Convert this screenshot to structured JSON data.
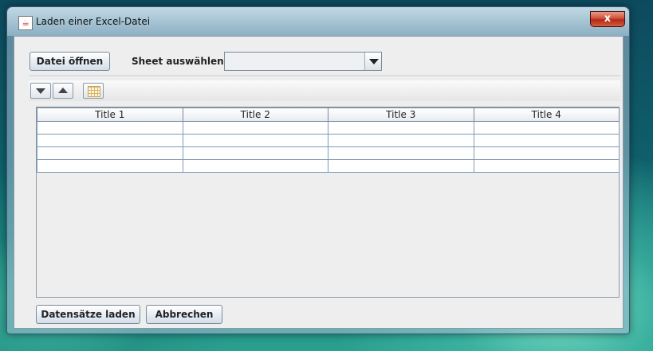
{
  "window": {
    "title": "Laden einer Excel-Datei",
    "close_label": "x"
  },
  "top": {
    "open_button": "Datei öffnen",
    "sheet_label": "Sheet auswählen:",
    "sheet_value": ""
  },
  "table": {
    "columns": [
      "Title 1",
      "Title 2",
      "Title 3",
      "Title 4"
    ],
    "rows": [
      [
        "",
        "",
        "",
        ""
      ],
      [
        "",
        "",
        "",
        ""
      ],
      [
        "",
        "",
        "",
        ""
      ],
      [
        "",
        "",
        "",
        ""
      ]
    ]
  },
  "bottom": {
    "load_button": "Datensätze laden",
    "cancel_button": "Abbrechen"
  },
  "colors": {
    "accent": "#7a8a99",
    "close": "#c4412a",
    "grid": "#7f9ab3"
  }
}
